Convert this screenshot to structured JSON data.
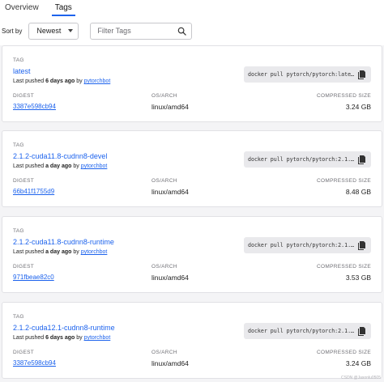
{
  "tabs": [
    {
      "label": "Overview",
      "active": false
    },
    {
      "label": "Tags",
      "active": true
    }
  ],
  "toolbar": {
    "sort_label": "Sort by",
    "sort_value": "Newest",
    "filter_placeholder": "Filter Tags"
  },
  "column_headers": {
    "tag": "TAG",
    "digest": "DIGEST",
    "os_arch": "OS/ARCH",
    "size": "COMPRESSED SIZE"
  },
  "cards": [
    {
      "name": "latest",
      "pushed_prefix": "Last pushed ",
      "pushed_age": "6 days ago",
      "pushed_by": " by ",
      "user": "pytorchbot",
      "pull_cmd": "docker pull pytorch/pytorch:late…",
      "digest": "3387e598cb94",
      "os_arch": "linux/amd64",
      "size": "3.24 GB"
    },
    {
      "name": "2.1.2-cuda11.8-cudnn8-devel",
      "pushed_prefix": "Last pushed ",
      "pushed_age": "a day ago",
      "pushed_by": " by ",
      "user": "pytorchbot",
      "pull_cmd": "docker pull pytorch/pytorch:2.1.…",
      "digest": "66b41f1755d9",
      "os_arch": "linux/amd64",
      "size": "8.48 GB"
    },
    {
      "name": "2.1.2-cuda11.8-cudnn8-runtime",
      "pushed_prefix": "Last pushed ",
      "pushed_age": "a day ago",
      "pushed_by": " by ",
      "user": "pytorchbot",
      "pull_cmd": "docker pull pytorch/pytorch:2.1.…",
      "digest": "971fbeae82c0",
      "os_arch": "linux/amd64",
      "size": "3.53 GB"
    },
    {
      "name": "2.1.2-cuda12.1-cudnn8-runtime",
      "pushed_prefix": "Last pushed ",
      "pushed_age": "6 days ago",
      "pushed_by": " by ",
      "user": "pytorchbot",
      "pull_cmd": "docker pull pytorch/pytorch:2.1.…",
      "digest": "3387e598cb94",
      "os_arch": "linux/amd64",
      "size": "3.24 GB"
    }
  ],
  "watermark": "CSDN @Jasonlu0505",
  "colors": {
    "link": "#1d63ed",
    "tab_underline": "#1d63ed",
    "page_bg": "#f4f4f6"
  },
  "icons": {
    "search": "search-icon",
    "copy": "copy-icon",
    "dropdown": "chevron-down-icon"
  }
}
